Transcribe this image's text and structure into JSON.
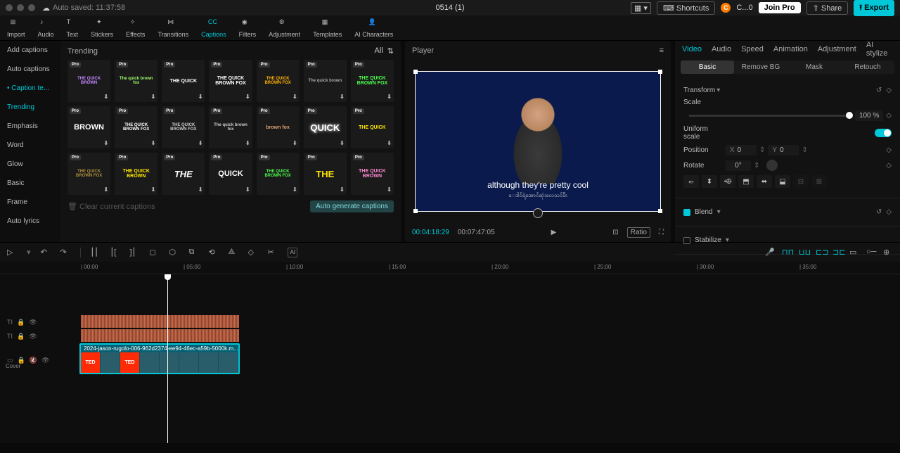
{
  "titlebar": {
    "auto_saved": "Auto saved: 11:37:58",
    "project_name": "0514 (1)",
    "shortcuts": "Shortcuts",
    "user_short": "C...0",
    "join_pro": "Join Pro",
    "share": "Share",
    "export": "Export"
  },
  "toolbar": {
    "items": [
      "Import",
      "Audio",
      "Text",
      "Stickers",
      "Effects",
      "Transitions",
      "Captions",
      "Filters",
      "Adjustment",
      "Templates",
      "AI Characters"
    ],
    "active_index": 6
  },
  "sidebar": {
    "items": [
      "Add captions",
      "Auto captions",
      "Caption te...",
      "Trending",
      "Emphasis",
      "Word",
      "Glow",
      "Basic",
      "Frame",
      "Auto lyrics"
    ],
    "active_index": 2,
    "highlight_index": 3
  },
  "gallery": {
    "title": "Trending",
    "all": "All",
    "clear_link": "Clear current captions",
    "generate": "Auto generate captions",
    "tiles": [
      {
        "label": "THE QUICK BROWN",
        "style": "color:#c184ff;font-size:6px"
      },
      {
        "label": "The quick brown fox",
        "style": "color:#9fff6b;font-size:6px"
      },
      {
        "label": "THE QUICK",
        "style": "color:#fff"
      },
      {
        "label": "THE QUICK BROWN FOX",
        "style": "color:#fff"
      },
      {
        "label": "THE QUICK BROWN FOX",
        "style": "color:#ffb300;font-size:6px"
      },
      {
        "label": "The quick brown",
        "style": "color:#aaa;font-size:6px"
      },
      {
        "label": "THE QUICK BROWN FOX",
        "style": "color:#4cff4c"
      },
      {
        "label": "BROWN",
        "style": "color:#fff;font-size:11px;font-weight:900"
      },
      {
        "label": "THE QUICK BROWN FOX",
        "style": "color:#fff;font-size:6px"
      },
      {
        "label": "THE QUICK BROWN FOX",
        "style": "color:#ccc;font-size:6px"
      },
      {
        "label": "The quick brown fox",
        "style": "color:#ccc;font-size:6px"
      },
      {
        "label": "brown fox",
        "style": "color:#d8a070"
      },
      {
        "label": "QUICK",
        "style": "color:#fff;font-size:13px;font-weight:900;text-shadow:0 0 4px #fff"
      },
      {
        "label": "THE QUICK",
        "style": "color:#ffe600"
      },
      {
        "label": "THE QUICK BROWN FOX",
        "style": "color:#aa8f3d;font-size:6px"
      },
      {
        "label": "THE QUICK BROWN",
        "style": "color:#ffe600;font-weight:900"
      },
      {
        "label": "THE",
        "style": "color:#fff;font-size:13px;font-style:italic;font-weight:900"
      },
      {
        "label": "QUICK",
        "style": "color:#fff;font-size:11px;font-weight:900"
      },
      {
        "label": "THE QUICK BROWN FOX",
        "style": "color:#4cff4c;font-size:6px"
      },
      {
        "label": "THE",
        "style": "color:#ffe600;font-size:13px;font-weight:900"
      },
      {
        "label": "THE QUICK BROWN",
        "style": "color:#ff8bd3"
      }
    ]
  },
  "player": {
    "title": "Player",
    "caption": "although they're pretty cool",
    "subcaption": "ေဒါင်ရဲ့အောင်ဆုံးလေသင်မီး",
    "current_time": "00:04:18:29",
    "duration": "00:07:47:05",
    "ratio": "Ratio"
  },
  "inspector": {
    "tabs": [
      "Video",
      "Audio",
      "Speed",
      "Animation",
      "Adjustment",
      "AI stylize"
    ],
    "subtabs": [
      "Basic",
      "Remove BG",
      "Mask",
      "Retouch"
    ],
    "transform": "Transform",
    "scale": "Scale",
    "scale_val": "100 %",
    "uniform": "Uniform scale",
    "position": "Position",
    "x_label": "X",
    "x_val": "0",
    "y_label": "Y",
    "y_val": "0",
    "rotate": "Rotate",
    "rotate_val": "0°",
    "blend": "Blend",
    "stabilize": "Stabilize"
  },
  "timeline": {
    "ticks": [
      "00:00",
      "05:00",
      "10:00",
      "15:00",
      "20:00",
      "25:00",
      "30:00",
      "35:00"
    ],
    "clip_name": "2024-jason-rugolo-006-962d2374-ee94-46ec-a59b-5000k.m...",
    "cover": "Cover",
    "ted": "TED"
  }
}
